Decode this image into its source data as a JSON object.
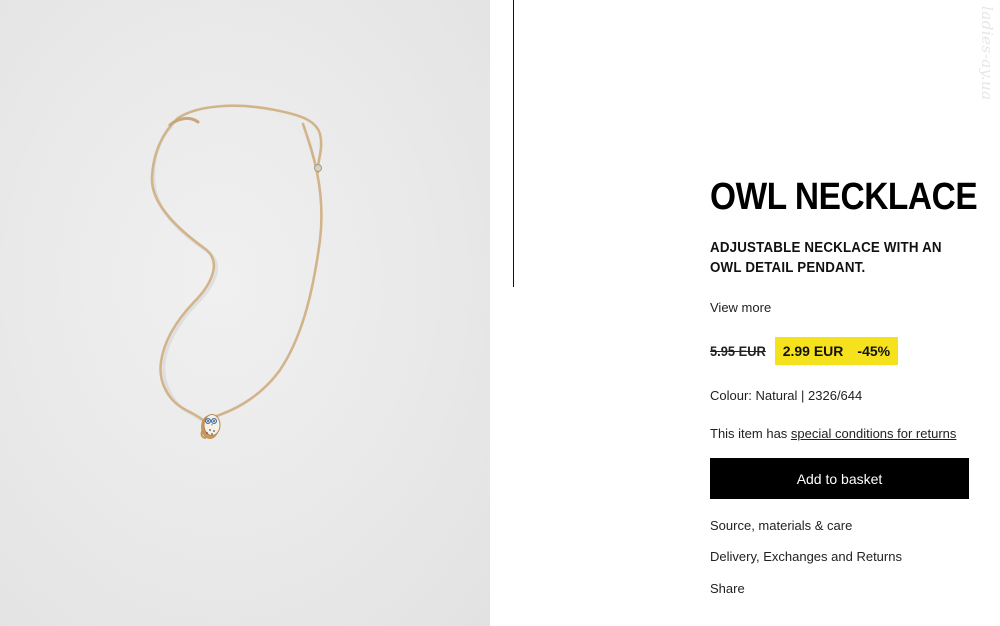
{
  "product": {
    "title": "OWL NECKLACE",
    "description": "ADJUSTABLE NECKLACE WITH AN OWL DETAIL PENDANT.",
    "view_more": "View more",
    "price": {
      "original": "5.95 EUR",
      "sale": "2.99 EUR",
      "discount": "-45%",
      "highlight_color": "#f6e21c"
    },
    "colour_line": "Colour: Natural | 2326/644",
    "returns": {
      "prefix": "This item has ",
      "link_text": "special conditions for returns"
    },
    "add_to_basket": "Add to basket",
    "links": {
      "source": "Source, materials & care",
      "delivery": "Delivery, Exchanges and Returns",
      "share": "Share"
    }
  },
  "watermark": "ladies-ay.ua",
  "image": {
    "icon": "owl-necklace-photo",
    "cord_color": "#d2b48c",
    "background_color": "#ebebeb"
  }
}
